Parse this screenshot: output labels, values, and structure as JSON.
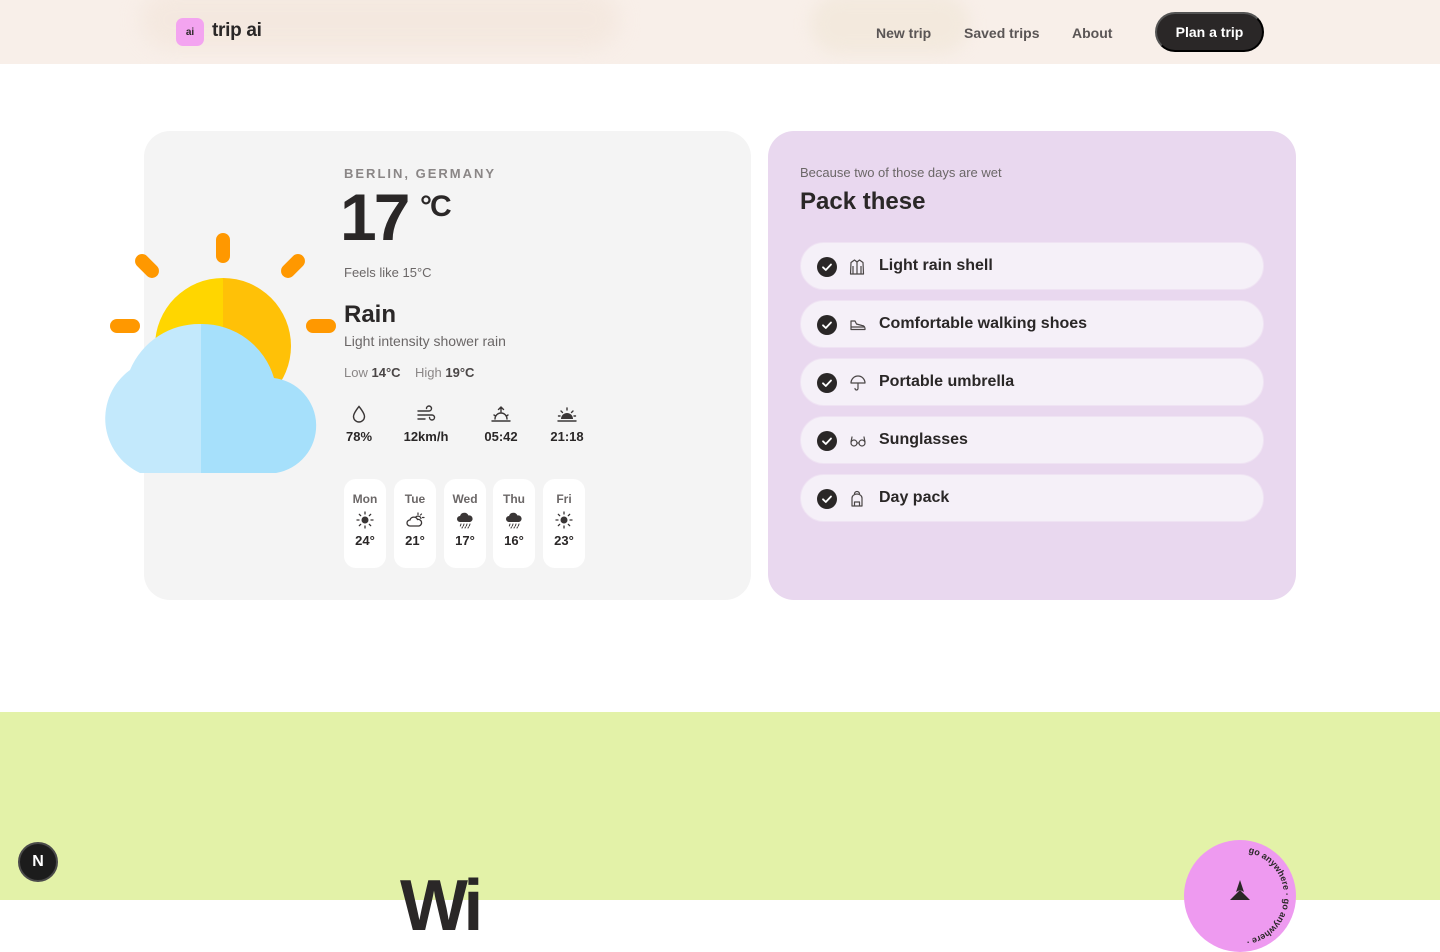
{
  "nav": {
    "logo_badge": "ai",
    "logo_text": "trip ai",
    "links": [
      "New trip",
      "Saved trips",
      "About"
    ],
    "cta": "Plan a trip"
  },
  "weather": {
    "location": "BERLIN, GERMANY",
    "temperature": "17",
    "unit": "°C",
    "feels_like": "Feels like 15°C",
    "condition": "Rain",
    "condition_detail": "Light intensity shower rain",
    "low_label": "Low",
    "low": "14°C",
    "high_label": "High",
    "high": "19°C",
    "stats": [
      {
        "icon": "humidity-icon",
        "value": "78%"
      },
      {
        "icon": "wind-icon",
        "value": "12km/h"
      },
      {
        "icon": "sunrise-icon",
        "value": "05:42"
      },
      {
        "icon": "sunset-icon",
        "value": "21:18"
      }
    ],
    "forecast": [
      {
        "day": "Mon",
        "icon": "sun-icon",
        "temp": "24°"
      },
      {
        "day": "Tue",
        "icon": "partly-cloudy-icon",
        "temp": "21°"
      },
      {
        "day": "Wed",
        "icon": "rain-cloud-icon",
        "temp": "17°"
      },
      {
        "day": "Thu",
        "icon": "rain-cloud-icon",
        "temp": "16°"
      },
      {
        "day": "Fri",
        "icon": "sun-icon",
        "temp": "23°"
      }
    ],
    "colors": {
      "sun": "#ffc107",
      "sun_rays": "#ff9800",
      "cloud": "#aee6fb"
    }
  },
  "packing": {
    "subtitle": "Because two of those days are wet",
    "title": "Pack these",
    "items": [
      {
        "icon": "jacket-icon",
        "label": "Light rain shell",
        "checked": true
      },
      {
        "icon": "shoe-icon",
        "label": "Comfortable walking shoes",
        "checked": true
      },
      {
        "icon": "umbrella-icon",
        "label": "Portable umbrella",
        "checked": true
      },
      {
        "icon": "glasses-icon",
        "label": "Sunglasses",
        "checked": true
      },
      {
        "icon": "backpack-icon",
        "label": "Day pack",
        "checked": true
      }
    ]
  },
  "footer": {
    "heading_fragment": "Wi",
    "stamp_text": "go anywhere · go anywhere · ",
    "dev_badge": "N"
  }
}
